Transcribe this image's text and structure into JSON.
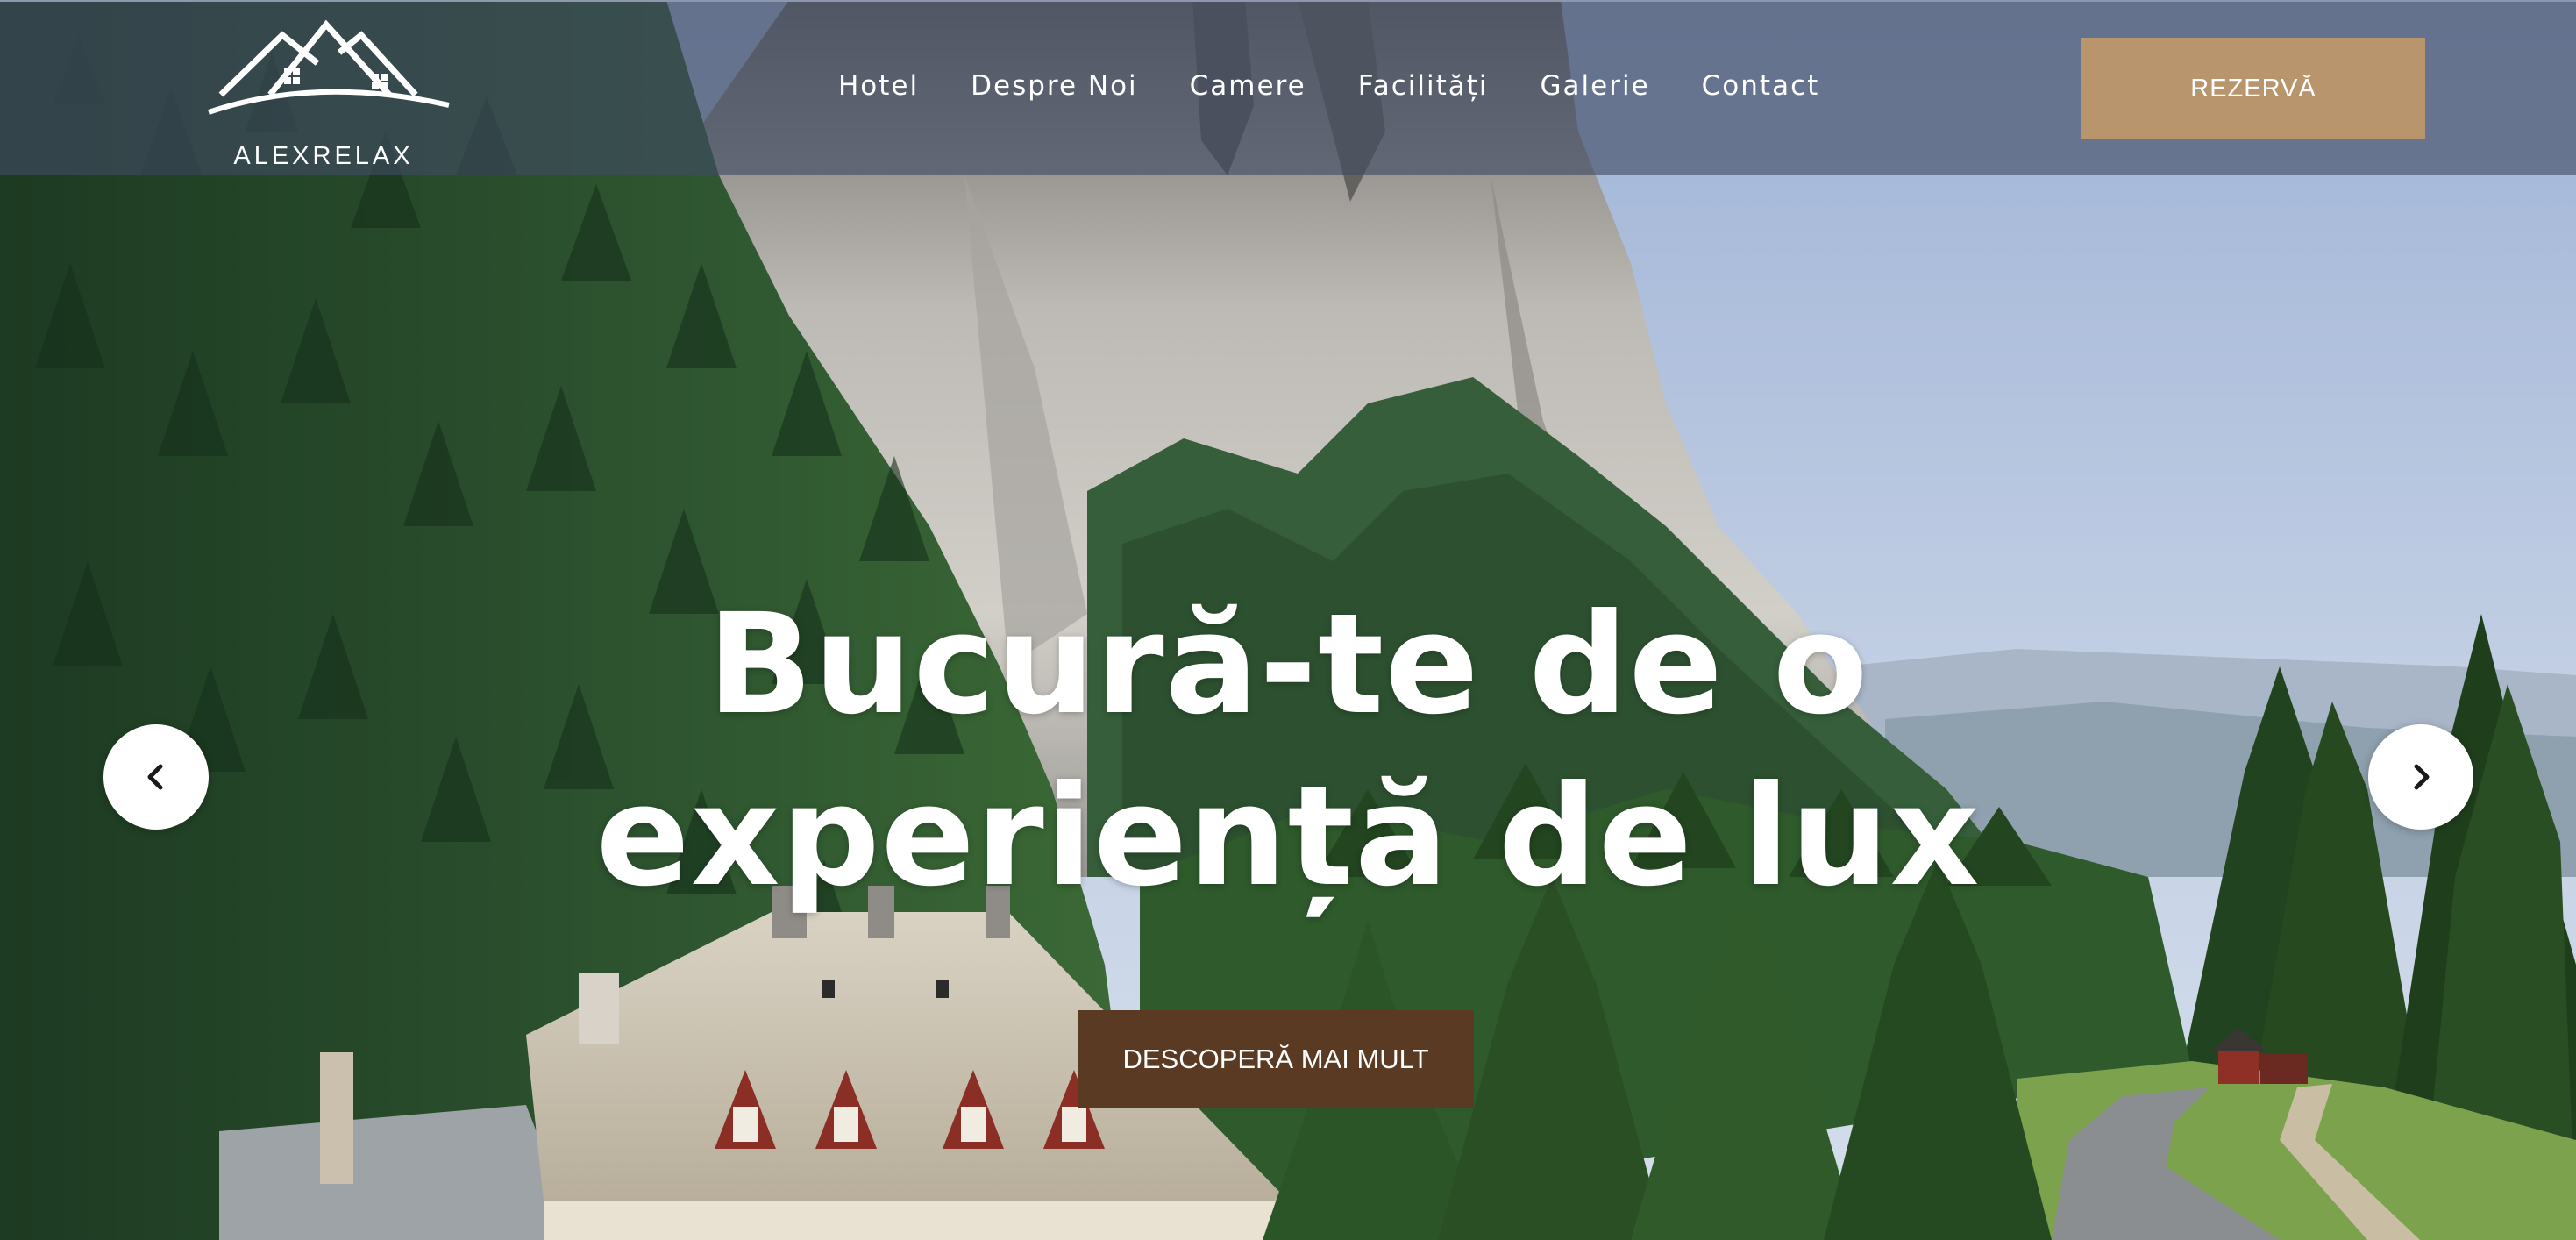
{
  "brand": {
    "name": "ALEXRELAX",
    "icon": "house-roof-logo"
  },
  "nav": {
    "items": [
      {
        "label": "Hotel"
      },
      {
        "label": "Despre Noi"
      },
      {
        "label": "Camere"
      },
      {
        "label": "Facilități"
      },
      {
        "label": "Galerie"
      },
      {
        "label": "Contact"
      }
    ]
  },
  "header": {
    "book_label": "REZERVĂ"
  },
  "hero": {
    "headline_line1": "Bucură-te de o",
    "headline_line2": "experiență de lux",
    "cta_label": "DESCOPERĂ MAI MULT",
    "prev_icon": "chevron-left-icon",
    "next_icon": "chevron-right-icon"
  },
  "colors": {
    "header_bg": "#404a62",
    "book_button": "#b8956c",
    "cta_button": "#5a3a22",
    "text": "#ffffff"
  }
}
